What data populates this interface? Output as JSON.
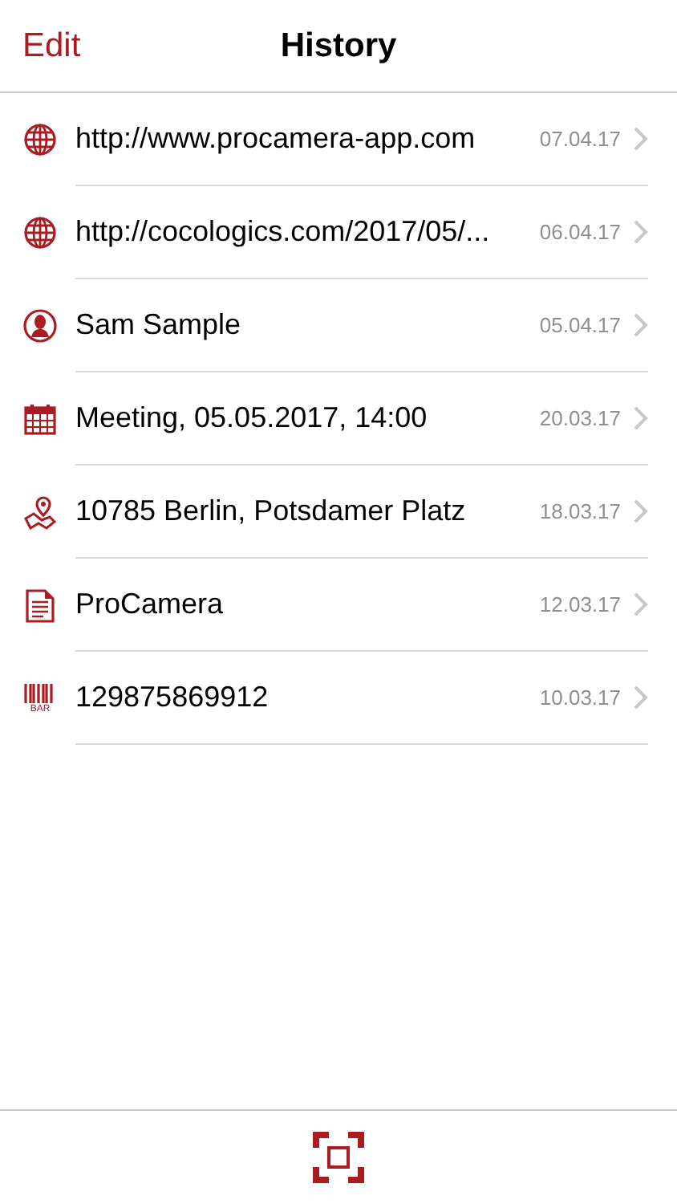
{
  "nav": {
    "edit": "Edit",
    "title": "History"
  },
  "items": [
    {
      "kind": "url",
      "text": "http://www.procamera-app.com",
      "date": "07.04.17"
    },
    {
      "kind": "url",
      "text": "http://cocologics.com/2017/05/...",
      "date": "06.04.17"
    },
    {
      "kind": "contact",
      "text": "Sam Sample",
      "date": "05.04.17"
    },
    {
      "kind": "event",
      "text": "Meeting, 05.05.2017, 14:00",
      "date": "20.03.17"
    },
    {
      "kind": "location",
      "text": "10785 Berlin, Potsdamer Platz",
      "date": "18.03.17"
    },
    {
      "kind": "text",
      "text": "ProCamera",
      "date": "12.03.17"
    },
    {
      "kind": "barcode",
      "text": "129875869912",
      "date": "10.03.17",
      "icon_label": "BAR"
    }
  ]
}
